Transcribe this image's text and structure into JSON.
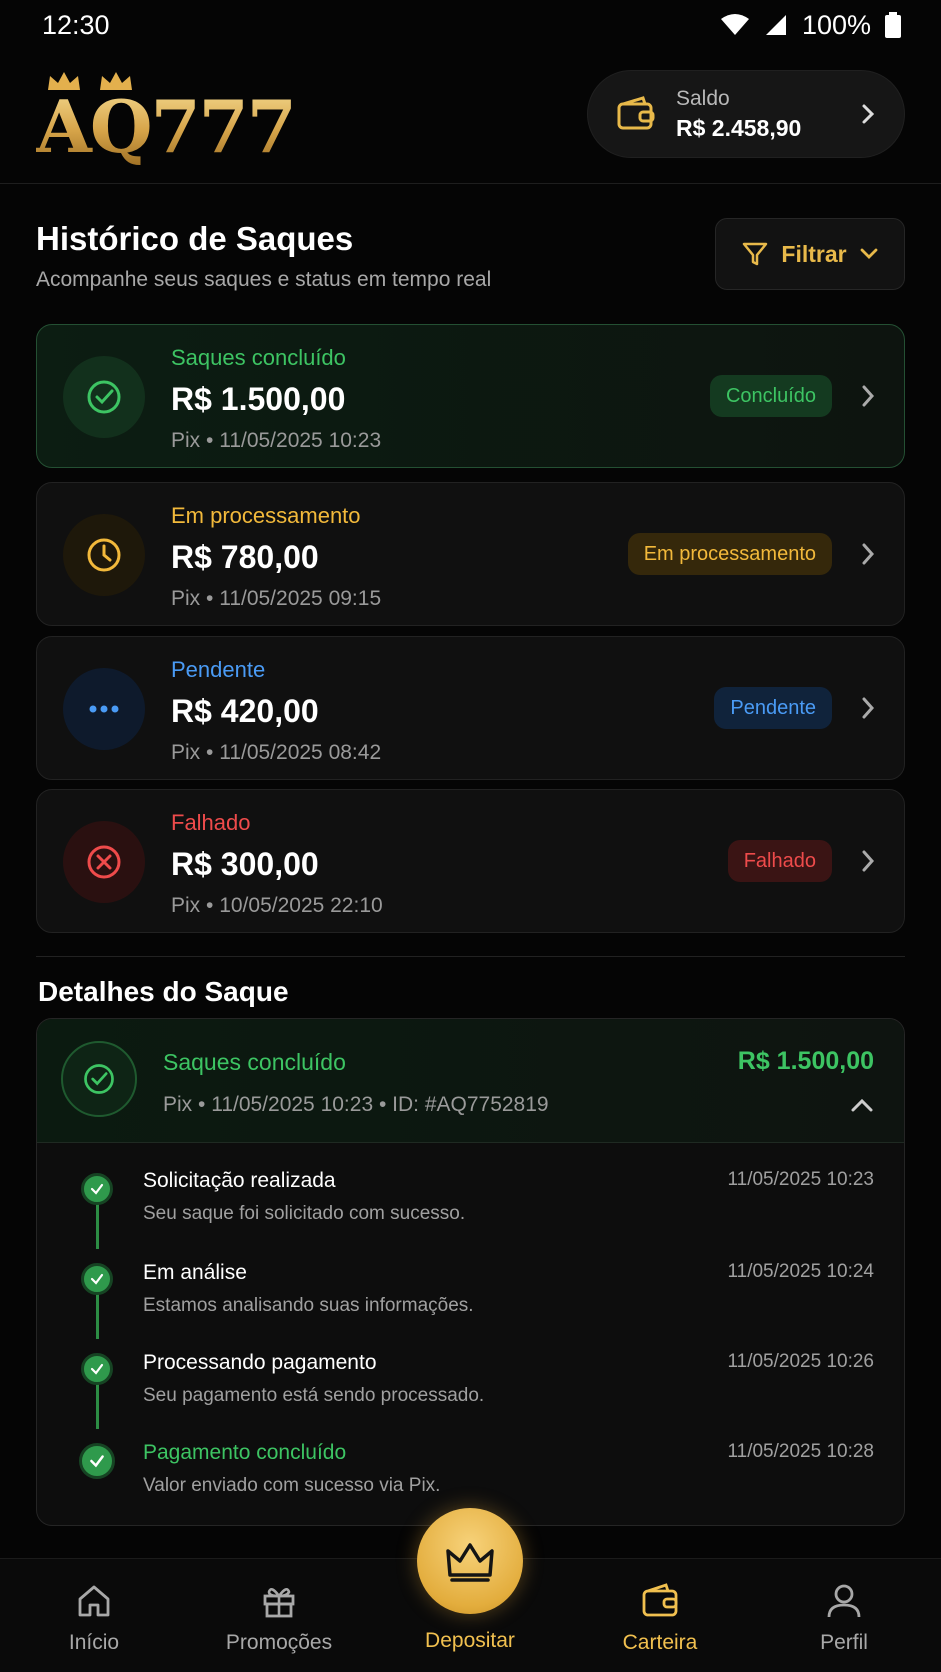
{
  "status_bar": {
    "time": "12:30",
    "battery": "100%"
  },
  "header": {
    "logo": "AQ777",
    "balance": {
      "label": "Saldo",
      "value": "R$ 2.458,90"
    }
  },
  "page": {
    "title": "Histórico de Saques",
    "subtitle": "Acompanhe seus saques e status em tempo real",
    "filter_label": "Filtrar"
  },
  "withdrawals": [
    {
      "state": "Saques concluído",
      "amount": "R$ 1.500,00",
      "meta": "Pix • 11/05/2025 10:23",
      "badge": "Concluído",
      "color": "#3dc463"
    },
    {
      "state": "Em processamento",
      "amount": "R$ 780,00",
      "meta": "Pix • 11/05/2025 09:15",
      "badge": "Em processamento",
      "color": "#f2b93b"
    },
    {
      "state": "Pendente",
      "amount": "R$ 420,00",
      "meta": "Pix • 11/05/2025 08:42",
      "badge": "Pendente",
      "color": "#4a9bf5"
    },
    {
      "state": "Falhado",
      "amount": "R$ 300,00",
      "meta": "Pix • 10/05/2025 22:10",
      "badge": "Falhado",
      "color": "#ee4b4b"
    }
  ],
  "details": {
    "title": "Detalhes do Saque",
    "state": "Saques concluído",
    "meta": "Pix • 11/05/2025 10:23 • ID: #AQ7752819",
    "amount": "R$ 1.500,00",
    "timeline": [
      {
        "title": "Solicitação realizada",
        "desc": "Seu saque foi solicitado com sucesso.",
        "time": "11/05/2025 10:23"
      },
      {
        "title": "Em análise",
        "desc": "Estamos analisando suas informações.",
        "time": "11/05/2025 10:24"
      },
      {
        "title": "Processando pagamento",
        "desc": "Seu pagamento está sendo processado.",
        "time": "11/05/2025 10:26"
      },
      {
        "title": "Pagamento concluído",
        "desc": "Valor enviado com sucesso via Pix.",
        "time": "11/05/2025 10:28"
      }
    ]
  },
  "nav": {
    "home": "Início",
    "promotions": "Promoções",
    "deposit": "Depositar",
    "wallet": "Carteira",
    "profile": "Perfil"
  },
  "icons": {
    "home": "home-icon",
    "promotions": "gift-icon",
    "deposit": "crown-icon",
    "wallet": "wallet-icon",
    "profile": "user-icon"
  },
  "colors": {
    "accent": "#f1c04f",
    "success": "#3dc463",
    "warning": "#f2b93b",
    "info": "#4a9bf5",
    "danger": "#ee4b4b"
  }
}
